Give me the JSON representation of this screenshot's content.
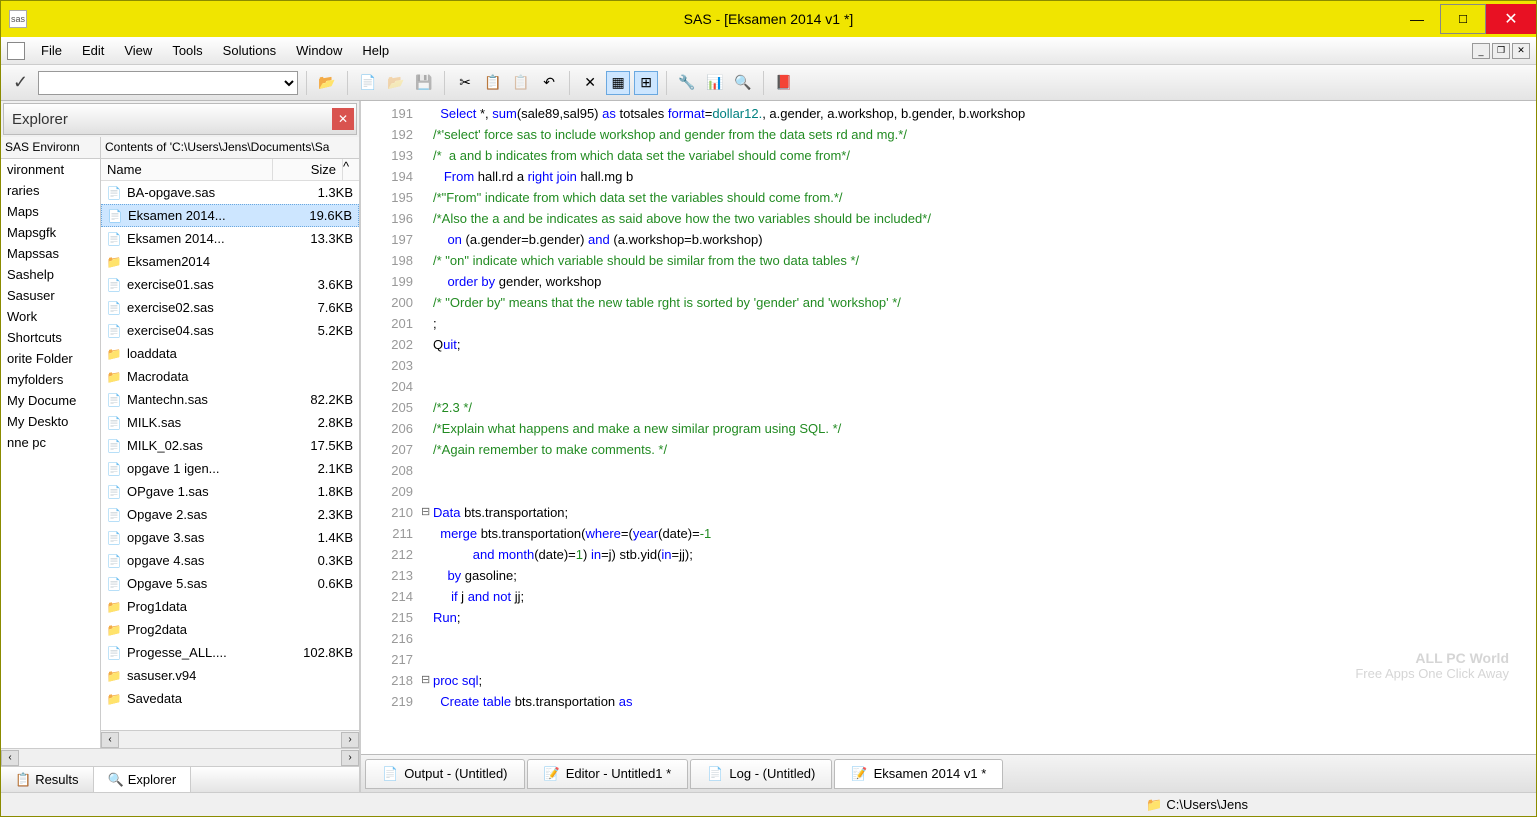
{
  "title": "SAS - [Eksamen 2014 v1 *]",
  "menu": [
    "File",
    "Edit",
    "View",
    "Tools",
    "Solutions",
    "Window",
    "Help"
  ],
  "explorer": {
    "title": "Explorer",
    "env_header": "SAS Environn",
    "files_header": "Contents of 'C:\\Users\\Jens\\Documents\\Sa",
    "col_name": "Name",
    "col_size": "Size",
    "env_items": [
      "vironment",
      "raries",
      "Maps",
      "Mapsgfk",
      "Mapssas",
      "Sashelp",
      "Sasuser",
      "Work",
      "Shortcuts",
      "orite Folder",
      "myfolders",
      "My Docume",
      "My Deskto",
      "nne pc"
    ],
    "files": [
      {
        "n": "BA-opgave.sas",
        "s": "1.3KB",
        "t": "sas"
      },
      {
        "n": "Eksamen 2014...",
        "s": "19.6KB",
        "t": "sas",
        "sel": true
      },
      {
        "n": "Eksamen 2014...",
        "s": "13.3KB",
        "t": "sas"
      },
      {
        "n": "Eksamen2014",
        "s": "",
        "t": "folder"
      },
      {
        "n": "exercise01.sas",
        "s": "3.6KB",
        "t": "sas"
      },
      {
        "n": "exercise02.sas",
        "s": "7.6KB",
        "t": "sas"
      },
      {
        "n": "exercise04.sas",
        "s": "5.2KB",
        "t": "sas"
      },
      {
        "n": "loaddata",
        "s": "",
        "t": "folder"
      },
      {
        "n": "Macrodata",
        "s": "",
        "t": "folder"
      },
      {
        "n": "Mantechn.sas",
        "s": "82.2KB",
        "t": "sas"
      },
      {
        "n": "MILK.sas",
        "s": "2.8KB",
        "t": "sas"
      },
      {
        "n": "MILK_02.sas",
        "s": "17.5KB",
        "t": "sas"
      },
      {
        "n": "opgave 1 igen...",
        "s": "2.1KB",
        "t": "sas"
      },
      {
        "n": "OPgave 1.sas",
        "s": "1.8KB",
        "t": "sas"
      },
      {
        "n": "Opgave 2.sas",
        "s": "2.3KB",
        "t": "sas"
      },
      {
        "n": "opgave 3.sas",
        "s": "1.4KB",
        "t": "sas"
      },
      {
        "n": "opgave 4.sas",
        "s": "0.3KB",
        "t": "sas"
      },
      {
        "n": "Opgave 5.sas",
        "s": "0.6KB",
        "t": "sas"
      },
      {
        "n": "Prog1data",
        "s": "",
        "t": "folder"
      },
      {
        "n": "Prog2data",
        "s": "",
        "t": "folder"
      },
      {
        "n": "Progesse_ALL....",
        "s": "102.8KB",
        "t": "sas"
      },
      {
        "n": "sasuser.v94",
        "s": "",
        "t": "folder"
      },
      {
        "n": "Savedata",
        "s": "",
        "t": "folder"
      }
    ],
    "tabs": [
      {
        "icon": "📋",
        "label": "Results"
      },
      {
        "icon": "🔍",
        "label": "Explorer",
        "active": true
      }
    ]
  },
  "code": [
    {
      "ln": 191,
      "tokens": [
        [
          "  ",
          ""
        ],
        [
          "Select",
          "kw"
        ],
        [
          " *, ",
          ""
        ],
        [
          "sum",
          "kw"
        ],
        [
          "(sale89,sal95) ",
          ""
        ],
        [
          "as",
          "kw"
        ],
        [
          " totsales ",
          ""
        ],
        [
          "format",
          "kw"
        ],
        [
          "=",
          ""
        ],
        [
          "dollar12.",
          "fn"
        ],
        [
          ", a.gender, a.workshop, b.gender, b.workshop",
          ""
        ]
      ]
    },
    {
      "ln": 192,
      "tokens": [
        [
          "/*'select' force sas to include workshop and gender from the data sets rd and mg.*/",
          "cm"
        ]
      ]
    },
    {
      "ln": 193,
      "tokens": [
        [
          "/*  a and b indicates from which data set the variabel should come from*/",
          "cm"
        ]
      ]
    },
    {
      "ln": 194,
      "tokens": [
        [
          "   ",
          ""
        ],
        [
          "From",
          "kw"
        ],
        [
          " hall.rd a ",
          ""
        ],
        [
          "right join",
          "kw"
        ],
        [
          " hall.mg b",
          ""
        ]
      ]
    },
    {
      "ln": 195,
      "tokens": [
        [
          "/*\"From\" indicate from which data set the variables should come from.*/",
          "cm"
        ]
      ]
    },
    {
      "ln": 196,
      "tokens": [
        [
          "/*Also the a and be indicates as said above how the two variables should be included*/",
          "cm"
        ]
      ]
    },
    {
      "ln": 197,
      "tokens": [
        [
          "    ",
          ""
        ],
        [
          "on",
          "kw"
        ],
        [
          " (a.gender=b.gender) ",
          ""
        ],
        [
          "and",
          "kw"
        ],
        [
          " (a.workshop=b.workshop)",
          ""
        ]
      ]
    },
    {
      "ln": 198,
      "tokens": [
        [
          "/* \"on\" indicate which variable should be similar from the two data tables */",
          "cm"
        ]
      ]
    },
    {
      "ln": 199,
      "tokens": [
        [
          "    ",
          ""
        ],
        [
          "order by",
          "kw"
        ],
        [
          " gender, workshop",
          ""
        ]
      ]
    },
    {
      "ln": 200,
      "tokens": [
        [
          "/* \"Order by\" means that the new table rght is sorted by 'gender' and 'workshop' */",
          "cm"
        ]
      ]
    },
    {
      "ln": 201,
      "tokens": [
        [
          ";",
          ""
        ]
      ]
    },
    {
      "ln": 202,
      "tokens": [
        [
          "Q",
          ""
        ],
        [
          "uit",
          "kw"
        ],
        [
          ";",
          ""
        ]
      ]
    },
    {
      "ln": 203,
      "tokens": [
        [
          "",
          ""
        ]
      ]
    },
    {
      "ln": 204,
      "tokens": [
        [
          "",
          ""
        ]
      ]
    },
    {
      "ln": 205,
      "tokens": [
        [
          "/*2.3 */",
          "cm"
        ]
      ]
    },
    {
      "ln": 206,
      "tokens": [
        [
          "/*Explain what happens and make a new similar program using SQL. */",
          "cm"
        ]
      ]
    },
    {
      "ln": 207,
      "tokens": [
        [
          "/*Again remember to make comments. */",
          "cm"
        ]
      ]
    },
    {
      "ln": 208,
      "tokens": [
        [
          "",
          ""
        ]
      ]
    },
    {
      "ln": 209,
      "tokens": [
        [
          "",
          ""
        ]
      ]
    },
    {
      "ln": 210,
      "fold": "⊟",
      "tokens": [
        [
          "Data",
          "kw"
        ],
        [
          " bts.transportation;",
          ""
        ]
      ]
    },
    {
      "ln": 211,
      "tokens": [
        [
          "  ",
          ""
        ],
        [
          "merge",
          "kw"
        ],
        [
          " bts.transportation(",
          ""
        ],
        [
          "where",
          "kw"
        ],
        [
          "=(",
          ""
        ],
        [
          "year",
          "kw"
        ],
        [
          "(date)=",
          ""
        ],
        [
          "-1",
          "bool"
        ]
      ]
    },
    {
      "ln": 212,
      "tokens": [
        [
          "           ",
          ""
        ],
        [
          "and",
          "kw"
        ],
        [
          " ",
          ""
        ],
        [
          "month",
          "kw"
        ],
        [
          "(date)=",
          ""
        ],
        [
          "1",
          "bool"
        ],
        [
          ") ",
          ""
        ],
        [
          "in",
          "kw"
        ],
        [
          "=j) stb.yid(",
          ""
        ],
        [
          "in",
          "kw"
        ],
        [
          "=jj);",
          ""
        ]
      ]
    },
    {
      "ln": 213,
      "tokens": [
        [
          "    ",
          ""
        ],
        [
          "by",
          "kw"
        ],
        [
          " gasoline;",
          ""
        ]
      ]
    },
    {
      "ln": 214,
      "tokens": [
        [
          "     ",
          ""
        ],
        [
          "if",
          "kw"
        ],
        [
          " j ",
          ""
        ],
        [
          "and",
          "kw"
        ],
        [
          " ",
          ""
        ],
        [
          "not",
          "kw"
        ],
        [
          " jj;",
          ""
        ]
      ]
    },
    {
      "ln": 215,
      "tokens": [
        [
          "Run",
          "kw"
        ],
        [
          ";",
          ""
        ]
      ]
    },
    {
      "ln": 216,
      "tokens": [
        [
          "",
          ""
        ]
      ]
    },
    {
      "ln": 217,
      "tokens": [
        [
          "",
          ""
        ]
      ]
    },
    {
      "ln": 218,
      "fold": "⊟",
      "tokens": [
        [
          "proc",
          "kw"
        ],
        [
          " ",
          ""
        ],
        [
          "sql",
          "kw"
        ],
        [
          ";",
          ""
        ]
      ]
    },
    {
      "ln": 219,
      "tokens": [
        [
          "  ",
          ""
        ],
        [
          "Create",
          "kw"
        ],
        [
          " ",
          ""
        ],
        [
          "table",
          "kw"
        ],
        [
          " bts.transportation ",
          ""
        ],
        [
          "as",
          "kw"
        ]
      ]
    }
  ],
  "editor_tabs": [
    {
      "icon": "📄",
      "label": "Output - (Untitled)"
    },
    {
      "icon": "📝",
      "label": "Editor - Untitled1 *"
    },
    {
      "icon": "📄",
      "label": "Log - (Untitled)"
    },
    {
      "icon": "📝",
      "label": "Eksamen 2014 v1 *",
      "active": true
    }
  ],
  "status": {
    "path": "C:\\Users\\Jens"
  },
  "watermark": {
    "line1": "ALL PC World",
    "line2": "Free Apps One Click Away"
  }
}
